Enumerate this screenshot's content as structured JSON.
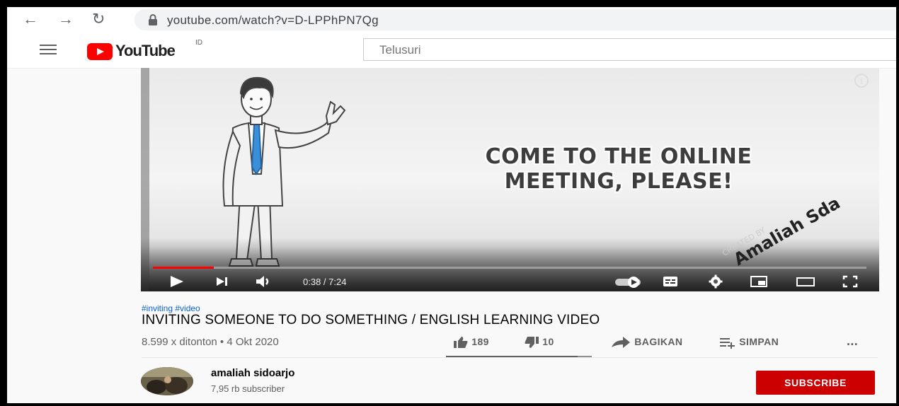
{
  "browser": {
    "back_icon": "arrow-left-icon",
    "forward_icon": "arrow-right-icon",
    "reload_icon": "reload-icon",
    "url": "youtube.com/watch?v=D-LPPhPN7Qg"
  },
  "header": {
    "logo_text": "YouTube",
    "country_code": "ID",
    "search_placeholder": "Telusuri"
  },
  "video": {
    "headline": "COME TO THE ONLINE MEETING, PLEASE!",
    "watermark_lines": [
      "CREATED BY",
      "Amaliah Sda"
    ],
    "time_display": "0:38 / 7:24",
    "progress_fraction": 0.085,
    "accent_color": "#ff0000"
  },
  "details": {
    "tags": "#inviting #video",
    "title": "INVITING SOMEONE TO DO SOMETHING / ENGLISH LEARNING VIDEO",
    "stats": "8.599 x ditonton • 4 Okt 2020",
    "likes": "189",
    "dislikes": "10",
    "share_label": "BAGIKAN",
    "save_label": "SIMPAN",
    "more_label": "..."
  },
  "channel": {
    "name": "amaliah sidoarjo",
    "subscribers": "7,95 rb subscriber",
    "subscribe_label": "SUBSCRIBE",
    "subscribe_color": "#cc0000"
  }
}
